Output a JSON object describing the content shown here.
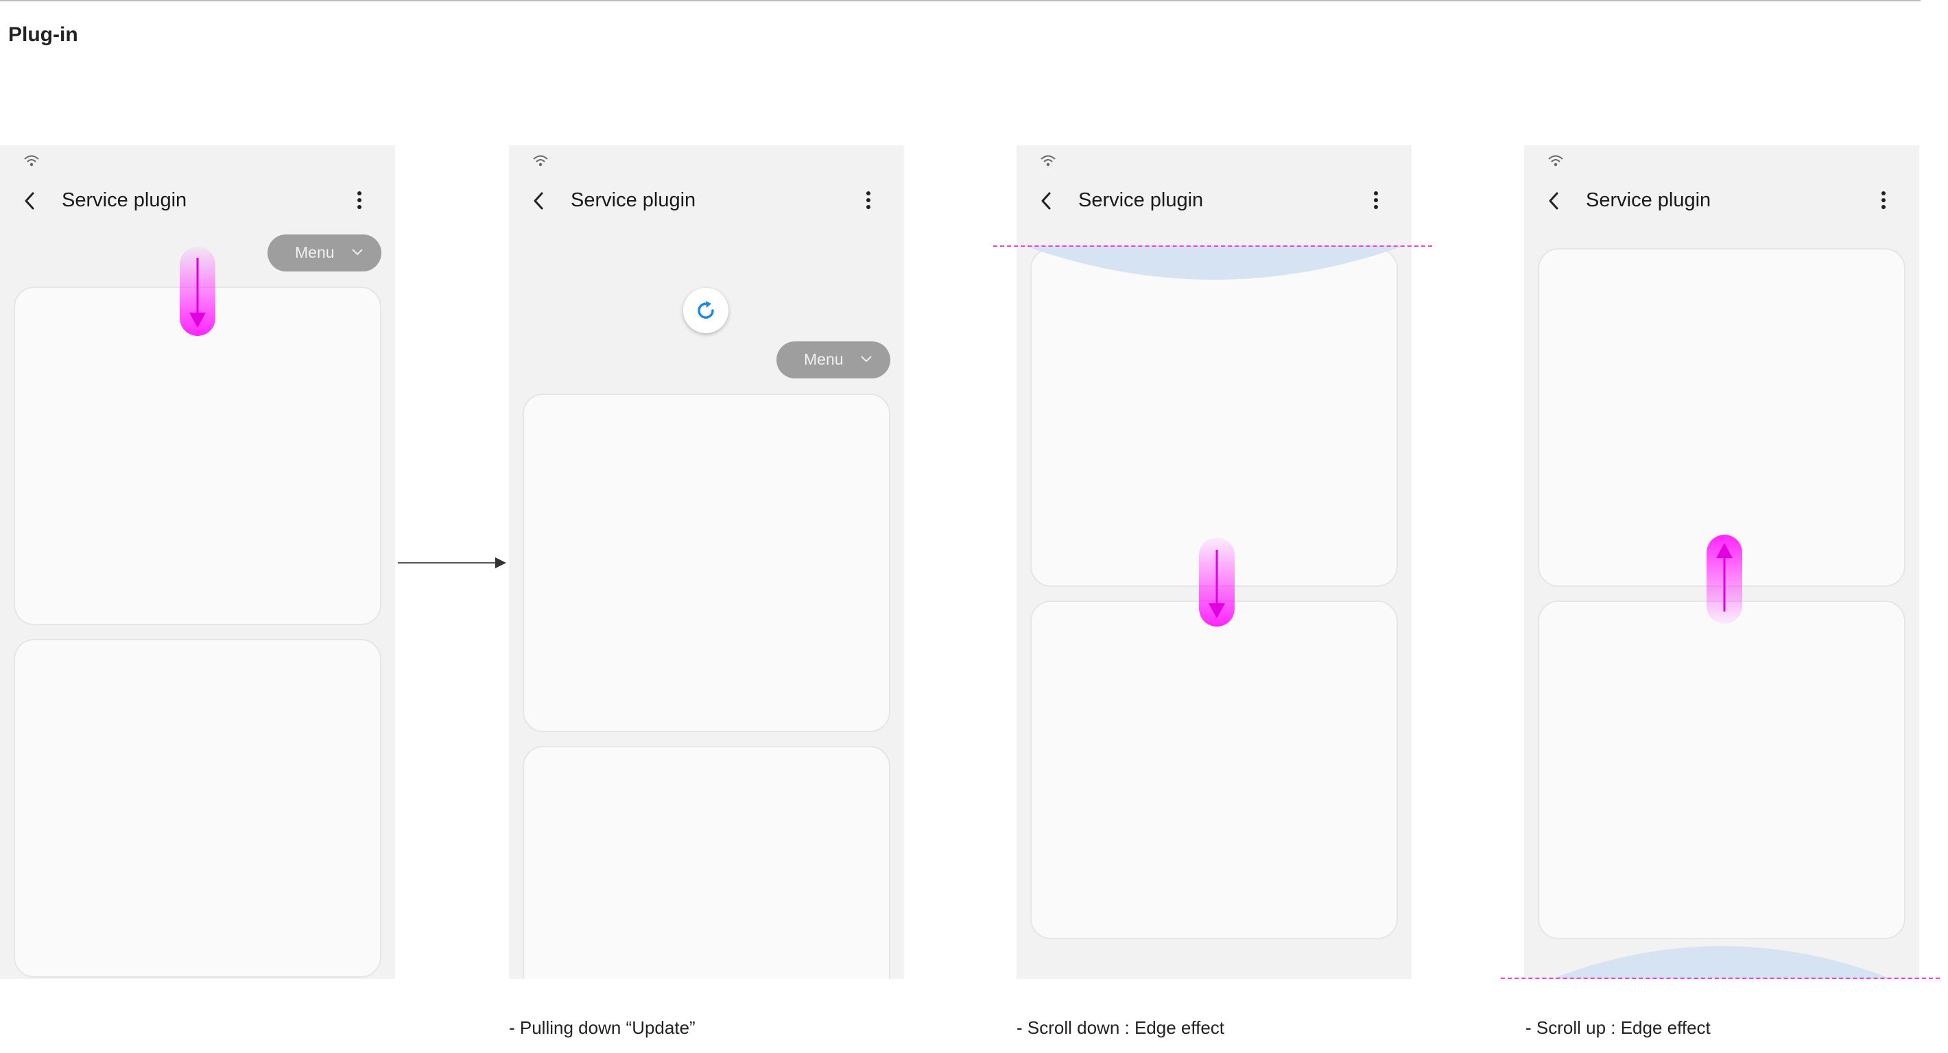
{
  "page": {
    "title": "Plug-in"
  },
  "screens": [
    {
      "app_title": "Service plugin",
      "menu_label": "Menu",
      "caption": ""
    },
    {
      "app_title": "Service plugin",
      "menu_label": "Menu",
      "caption": "- Pulling down “Update”"
    },
    {
      "app_title": "Service plugin",
      "caption": "- Scroll down : Edge effect"
    },
    {
      "app_title": "Service plugin",
      "caption": "- Scroll up : Edge effect"
    }
  ],
  "icons": {
    "status": "wifi-icon",
    "back": "back-arrow-icon",
    "more": "more-vert-icon",
    "dropdown": "chevron-down-icon",
    "refresh": "refresh-icon",
    "gesture_down": "swipe-down-gesture-icon",
    "gesture_up": "swipe-up-gesture-icon"
  },
  "colors": {
    "screen_bg": "#f2f2f2",
    "card_bg": "#fafafa",
    "menu_chip": "#9e9e9e",
    "gesture": "#ff00ff",
    "refresh_accent": "#1e88e5",
    "edge_glow": "#d6e3f3",
    "edge_guide": "#f040d0"
  }
}
